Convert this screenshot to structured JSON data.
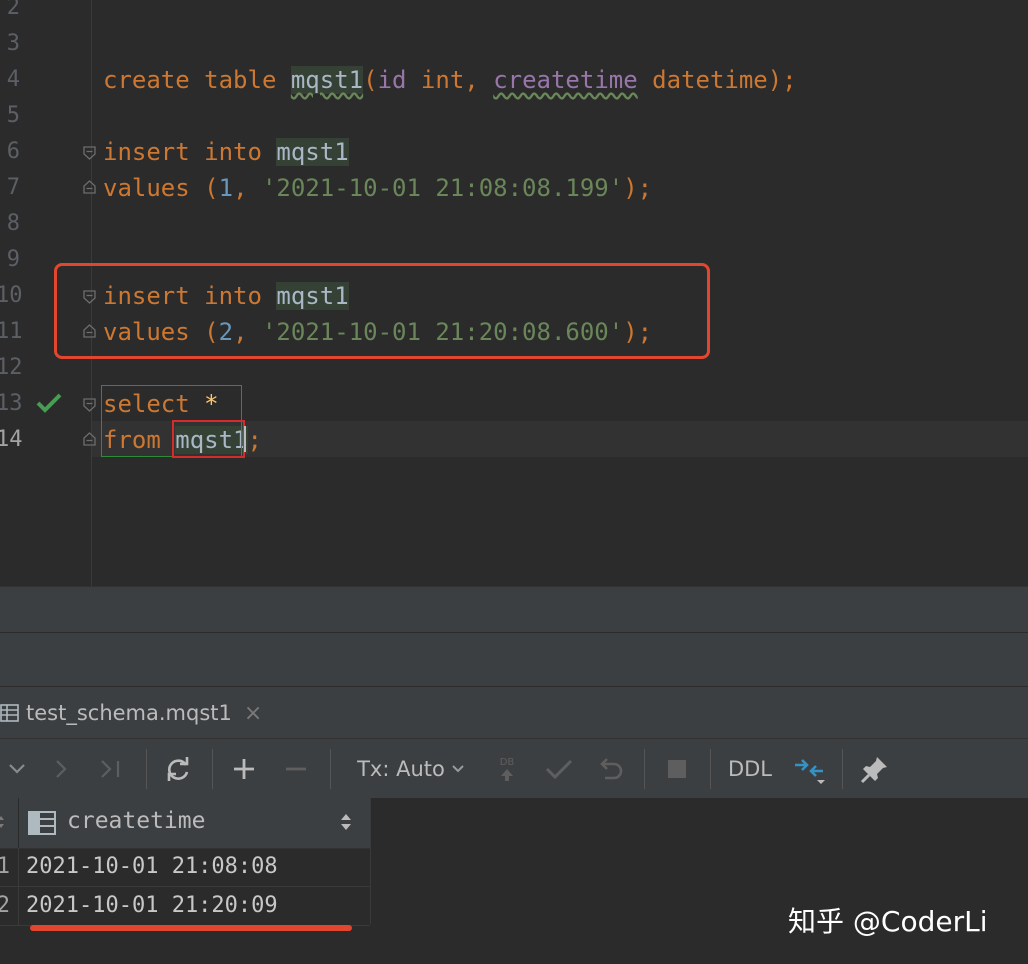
{
  "editor": {
    "line_numbers": [
      "2",
      "3",
      "4",
      "5",
      "6",
      "7",
      "8",
      "9",
      "10",
      "11",
      "12",
      "13",
      "14"
    ],
    "line4": {
      "create": "create",
      "table": "table",
      "name": "mqst1",
      "open": "(",
      "id": "id",
      "int": "int",
      "comma": ", ",
      "createtime": "createtime",
      "datetime": "datetime",
      "close": ");"
    },
    "line6": {
      "insert": "insert",
      "into": "into",
      "name": "mqst1"
    },
    "line7": {
      "values": "values",
      "open": " (",
      "num": "1",
      "comma": ", ",
      "str": "'2021-10-01 21:08:08.199'",
      "close": ");"
    },
    "line10": {
      "insert": "insert",
      "into": "into",
      "name": "mqst1"
    },
    "line11": {
      "values": "values",
      "open": " (",
      "num": "2",
      "comma": ", ",
      "str": "'2021-10-01 21:20:08.600'",
      "close": ");"
    },
    "line13": {
      "select": "select",
      "star": "*"
    },
    "line14": {
      "from": "from",
      "name": "mqst1",
      "semi": ";"
    }
  },
  "results": {
    "tab_label": "test_schema.mqst1",
    "tab_close": "×",
    "toolbar": {
      "tx_label": "Tx: Auto",
      "ddl_label": "DDL",
      "db_label": "DB"
    },
    "column_header": "createtime",
    "rows": [
      {
        "num": "1",
        "value": "2021-10-01 21:08:08"
      },
      {
        "num": "2",
        "value": "2021-10-01 21:20:09"
      }
    ]
  },
  "watermark": "知乎 @CoderLi",
  "colors": {
    "editor_bg": "#2b2b2b",
    "keyword": "#cc7832",
    "string": "#6a8759",
    "number": "#6897bb",
    "column": "#9876aa",
    "highlight_red": "#e2462f",
    "check_green": "#499c54"
  }
}
